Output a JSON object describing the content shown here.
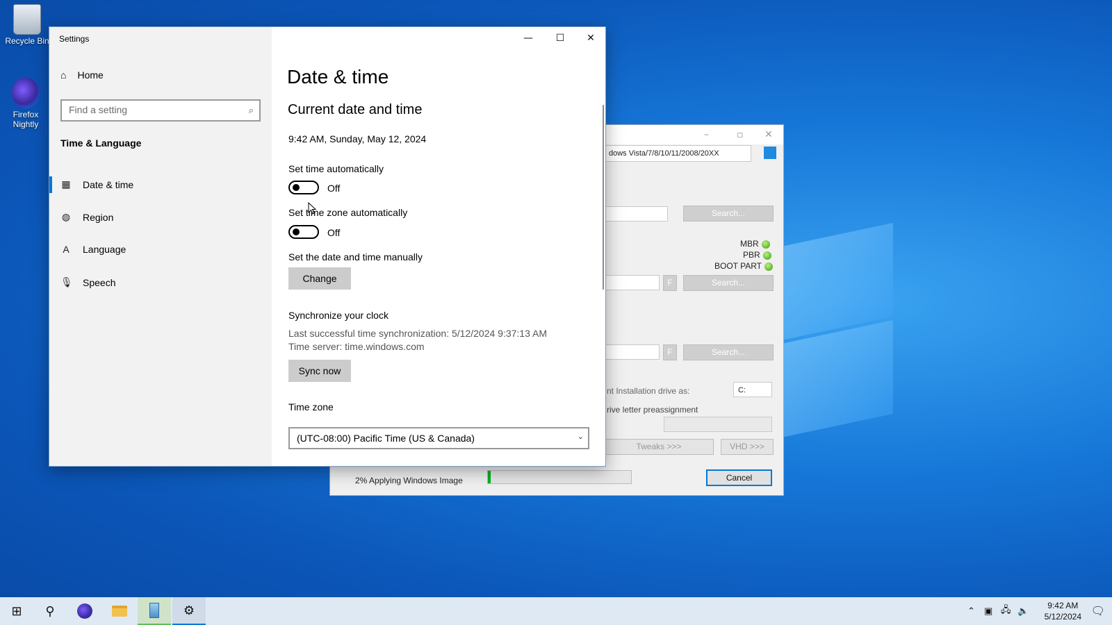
{
  "desktop": {
    "icons": [
      {
        "label": "Recycle Bin"
      },
      {
        "label": "Firefox Nightly"
      }
    ]
  },
  "installer": {
    "edition_field": "dows Vista/7/8/10/11/2008/20XX",
    "search_1": "Search...",
    "search_2": "Search...",
    "search_3": "Search...",
    "f_label": "F",
    "mbr": "MBR",
    "pbr": "PBR",
    "boot_part": "BOOT PART",
    "mount_label": "nt Installation drive as:",
    "drive_value": "C:",
    "preassign_label": "rive letter preassignment",
    "tweaks": "Tweaks >>>",
    "vhd": "VHD >>>",
    "status": "2% Applying Windows Image",
    "progress_fraction": 0.02,
    "cancel": "Cancel"
  },
  "settings": {
    "window_title": "Settings",
    "nav": {
      "home": "Home",
      "search_placeholder": "Find a setting",
      "section": "Time & Language",
      "items": [
        {
          "label": "Date & time",
          "icon": "calendar-clock-icon"
        },
        {
          "label": "Region",
          "icon": "globe-icon"
        },
        {
          "label": "Language",
          "icon": "language-icon"
        },
        {
          "label": "Speech",
          "icon": "microphone-icon"
        }
      ]
    },
    "content": {
      "page_title": "Date & time",
      "section_title": "Current date and time",
      "current_datetime": "9:42 AM, Sunday, May 12, 2024",
      "set_time_auto_label": "Set time automatically",
      "set_time_auto_state": "Off",
      "set_tz_auto_label": "Set time zone automatically",
      "set_tz_auto_state": "Off",
      "manual_label": "Set the date and time manually",
      "change_button": "Change",
      "sync_title": "Synchronize your clock",
      "last_sync": "Last successful time synchronization: 5/12/2024 9:37:13 AM",
      "time_server": "Time server: time.windows.com",
      "sync_button": "Sync now",
      "timezone_label": "Time zone",
      "timezone_value": "(UTC-08:00) Pacific Time (US & Canada)"
    }
  },
  "taskbar": {
    "time": "9:42 AM",
    "date": "5/12/2024"
  }
}
